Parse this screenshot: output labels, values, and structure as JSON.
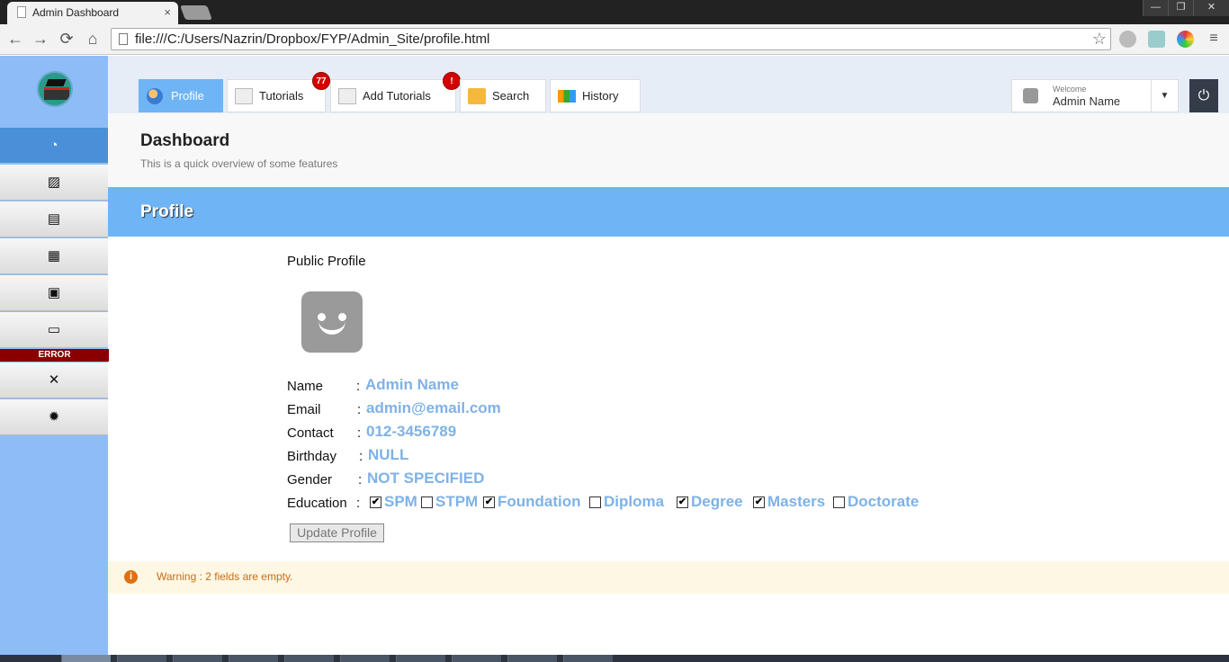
{
  "browser": {
    "tab_title": "Admin Dashboard",
    "tab_close": "×",
    "address": "file:///C:/Users/Nazrin/Dropbox/FYP/Admin_Site/profile.html",
    "back": "←",
    "forward": "→",
    "reload": "⟳",
    "home": "⌂",
    "star": "☆",
    "window_min": "—",
    "window_restore": "❐",
    "window_close": "✕"
  },
  "sidebar": {
    "items": [
      {
        "icon": "dashboard-icon",
        "glyph": "◔"
      },
      {
        "icon": "image-icon",
        "glyph": "▨"
      },
      {
        "icon": "layout-icon",
        "glyph": "▤"
      },
      {
        "icon": "grid-icon",
        "glyph": "▦"
      },
      {
        "icon": "calendar-icon",
        "glyph": "▣"
      },
      {
        "icon": "chat-icon",
        "glyph": "▭"
      },
      {
        "icon": "plug-icon",
        "glyph": "✕"
      },
      {
        "icon": "gear-icon",
        "glyph": "✹"
      }
    ],
    "error_label": "ERROR"
  },
  "topnav": {
    "tabs": [
      {
        "label": "Profile",
        "icon": "user-icon",
        "badge": ""
      },
      {
        "label": "Tutorials",
        "icon": "document-icon",
        "badge": "77"
      },
      {
        "label": "Add Tutorials",
        "icon": "add-document-icon",
        "badge": "!"
      },
      {
        "label": "Search",
        "icon": "folder-icon",
        "badge": ""
      },
      {
        "label": "History",
        "icon": "windows-icon",
        "badge": ""
      }
    ],
    "user": {
      "welcome": "Welcome",
      "name": "Admin Name",
      "caret": "▼"
    },
    "power": "⏻"
  },
  "header": {
    "title": "Dashboard",
    "subtitle": "This is a quick overview of some features"
  },
  "section": {
    "title": "Profile"
  },
  "profile": {
    "heading": "Public Profile",
    "fields": [
      {
        "label": "Name",
        "value": "Admin Name"
      },
      {
        "label": "Email",
        "value": "admin@email.com"
      },
      {
        "label": "Contact",
        "value": "012-3456789"
      },
      {
        "label": "Birthday",
        "value": "NULL"
      },
      {
        "label": "Gender",
        "value": "NOT SPECIFIED"
      }
    ],
    "education_label": "Education",
    "education": [
      {
        "label": "SPM",
        "checked": true
      },
      {
        "label": "STPM",
        "checked": false
      },
      {
        "label": "Foundation",
        "checked": true
      },
      {
        "label": "Diploma",
        "checked": false
      },
      {
        "label": "Degree",
        "checked": true
      },
      {
        "label": "Masters",
        "checked": true
      },
      {
        "label": "Doctorate",
        "checked": false
      }
    ],
    "update_button": "Update Profile"
  },
  "warning": {
    "icon": "i",
    "text": "Warning : 2 fields are empty."
  },
  "colors": {
    "accent": "#6fb4f5",
    "sidebar": "#8ebcf7",
    "value_text": "#7fb2e6",
    "warning": "#d06a10",
    "error": "#8a0000"
  }
}
